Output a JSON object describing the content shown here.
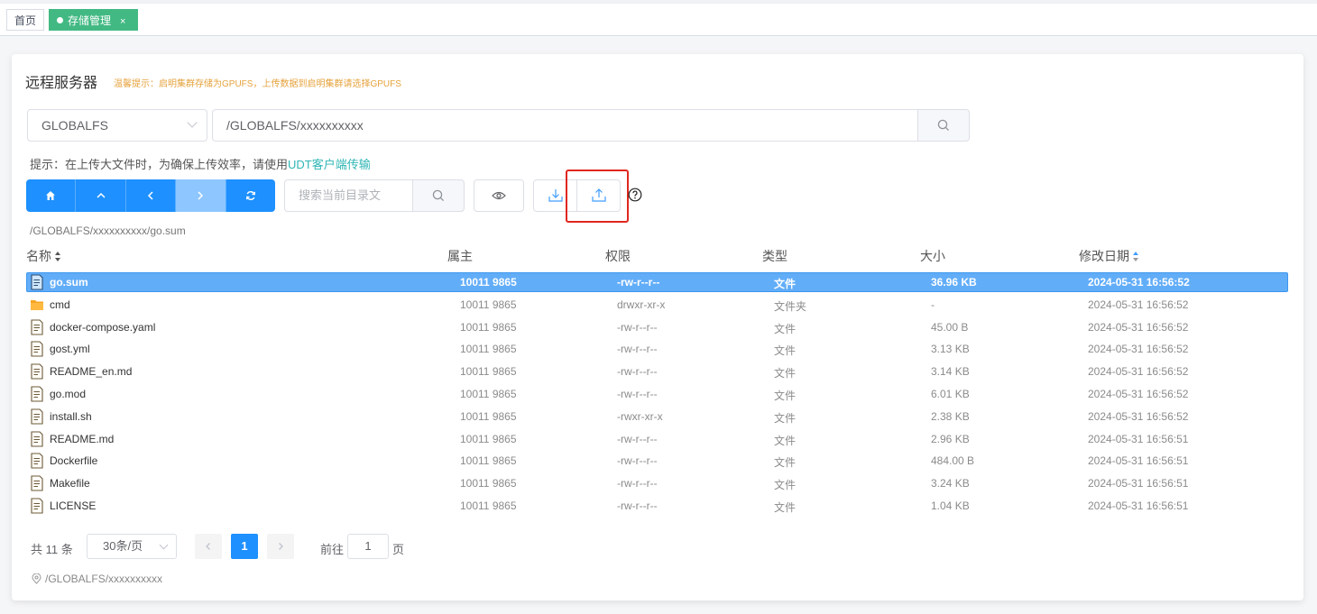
{
  "tags": {
    "home": "首页",
    "active": "存储管理",
    "close": "×"
  },
  "header": {
    "title": "远程服务器",
    "warm_tip": "温馨提示：启明集群存储为GPUFS，上传数据到启明集群请选择GPUFS"
  },
  "storage": {
    "selected": "GLOBALFS",
    "path_value": "/GLOBALFS/xxxxxxxxxx"
  },
  "hint": {
    "prefix": "提示：在上传大文件时，为确保上传效率，请使用",
    "link": "UDT客户端传输"
  },
  "toolbar": {
    "filter_placeholder": "搜索当前目录文"
  },
  "current_path": "/GLOBALFS/xxxxxxxxxx/go.sum",
  "table": {
    "columns": [
      "名称",
      "属主",
      "权限",
      "类型",
      "大小",
      "修改日期"
    ],
    "rows": [
      {
        "name": "go.sum",
        "owner": "10011 9865",
        "perm": "-rw-r--r--",
        "type": "文件",
        "size": "36.96 KB",
        "mtime": "2024-05-31 16:56:52",
        "kind": "file",
        "selected": true
      },
      {
        "name": "cmd",
        "owner": "10011 9865",
        "perm": "drwxr-xr-x",
        "type": "文件夹",
        "size": "-",
        "mtime": "2024-05-31 16:56:52",
        "kind": "folder"
      },
      {
        "name": "docker-compose.yaml",
        "owner": "10011 9865",
        "perm": "-rw-r--r--",
        "type": "文件",
        "size": "45.00 B",
        "mtime": "2024-05-31 16:56:52",
        "kind": "file"
      },
      {
        "name": "gost.yml",
        "owner": "10011 9865",
        "perm": "-rw-r--r--",
        "type": "文件",
        "size": "3.13 KB",
        "mtime": "2024-05-31 16:56:52",
        "kind": "file"
      },
      {
        "name": "README_en.md",
        "owner": "10011 9865",
        "perm": "-rw-r--r--",
        "type": "文件",
        "size": "3.14 KB",
        "mtime": "2024-05-31 16:56:52",
        "kind": "file"
      },
      {
        "name": "go.mod",
        "owner": "10011 9865",
        "perm": "-rw-r--r--",
        "type": "文件",
        "size": "6.01 KB",
        "mtime": "2024-05-31 16:56:52",
        "kind": "file"
      },
      {
        "name": "install.sh",
        "owner": "10011 9865",
        "perm": "-rwxr-xr-x",
        "type": "文件",
        "size": "2.38 KB",
        "mtime": "2024-05-31 16:56:52",
        "kind": "file"
      },
      {
        "name": "README.md",
        "owner": "10011 9865",
        "perm": "-rw-r--r--",
        "type": "文件",
        "size": "2.96 KB",
        "mtime": "2024-05-31 16:56:51",
        "kind": "file"
      },
      {
        "name": "Dockerfile",
        "owner": "10011 9865",
        "perm": "-rw-r--r--",
        "type": "文件",
        "size": "484.00 B",
        "mtime": "2024-05-31 16:56:51",
        "kind": "file"
      },
      {
        "name": "Makefile",
        "owner": "10011 9865",
        "perm": "-rw-r--r--",
        "type": "文件",
        "size": "3.24 KB",
        "mtime": "2024-05-31 16:56:51",
        "kind": "file"
      },
      {
        "name": "LICENSE",
        "owner": "10011 9865",
        "perm": "-rw-r--r--",
        "type": "文件",
        "size": "1.04 KB",
        "mtime": "2024-05-31 16:56:51",
        "kind": "file"
      }
    ]
  },
  "pagination": {
    "total": "共 11 条",
    "page_size": "30条/页",
    "current_page": "1",
    "goto_prefix": "前往",
    "goto_value": "1",
    "goto_suffix": "页"
  },
  "footer_path": "/GLOBALFS/xxxxxxxxxx",
  "colors": {
    "primary": "#1e90ff",
    "active_tag": "#42b983",
    "selected_row": "#62adf8",
    "warning": "#e6a23c",
    "highlight_box": "#e0271e"
  }
}
